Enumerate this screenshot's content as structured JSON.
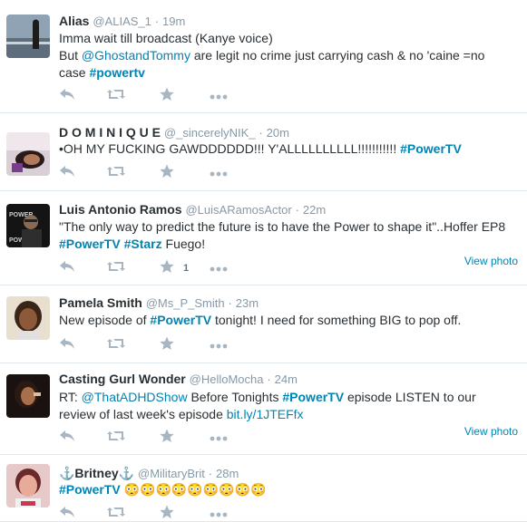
{
  "tweets": [
    {
      "name": "Alias",
      "handle": "@ALIAS_1",
      "time": "19m",
      "lines": [
        [
          {
            "t": "Imma wait till broadcast (Kanye voice)",
            "k": "text"
          }
        ],
        [
          {
            "t": "But ",
            "k": "text"
          },
          {
            "t": "@GhostandTommy",
            "k": "link"
          },
          {
            "t": " are legit no crime just carrying cash & no 'caine =no",
            "k": "text"
          }
        ],
        [
          {
            "t": "case ",
            "k": "text"
          },
          {
            "t": "#powertv",
            "k": "hashtag"
          }
        ]
      ],
      "fav_count": "",
      "view_photo": ""
    },
    {
      "name": "D O M I N I Q U E",
      "handle": "@_sincerelyNIK_",
      "time": "20m",
      "lines": [
        [
          {
            "t": "•OH MY FUCKING GAWDDDDDD!!! Y'ALLLLLLLLLL!!!!!!!!!!! ",
            "k": "text"
          },
          {
            "t": "#PowerTV",
            "k": "hashtag"
          }
        ]
      ],
      "fav_count": "",
      "view_photo": ""
    },
    {
      "name": "Luis Antonio Ramos",
      "handle": "@LuisARamosActor",
      "time": "22m",
      "lines": [
        [
          {
            "t": "\"The only way to predict the future is to have the Power to shape it\"..Hoffer EP8",
            "k": "text"
          }
        ],
        [
          {
            "t": "#PowerTV",
            "k": "hashtag"
          },
          {
            "t": " ",
            "k": "text"
          },
          {
            "t": "#Starz",
            "k": "hashtag"
          },
          {
            "t": " Fuego!",
            "k": "text"
          }
        ]
      ],
      "fav_count": "1",
      "view_photo": "View photo"
    },
    {
      "name": "Pamela Smith",
      "handle": "@Ms_P_Smith",
      "time": "23m",
      "lines": [
        [
          {
            "t": "New episode of ",
            "k": "text"
          },
          {
            "t": "#PowerTV",
            "k": "hashtag"
          },
          {
            "t": " tonight! I need for something BIG to pop off.",
            "k": "text"
          }
        ]
      ],
      "fav_count": "",
      "view_photo": ""
    },
    {
      "name": "Casting Gurl Wonder",
      "handle": "@HelloMocha",
      "time": "24m",
      "lines": [
        [
          {
            "t": "RT: ",
            "k": "text"
          },
          {
            "t": "@ThatADHDShow",
            "k": "link"
          },
          {
            "t": " Before Tonights ",
            "k": "text"
          },
          {
            "t": "#PowerTV",
            "k": "hashtag"
          },
          {
            "t": " episode LISTEN to our",
            "k": "text"
          }
        ],
        [
          {
            "t": "review of last week's episode ",
            "k": "text"
          },
          {
            "t": "bit.ly/1JTEFfx",
            "k": "link"
          }
        ]
      ],
      "fav_count": "",
      "view_photo": "View photo"
    },
    {
      "name": "⚓Britney⚓",
      "handle": "@MilitaryBrit",
      "time": "28m",
      "lines": [
        [
          {
            "t": "#PowerTV",
            "k": "hashtag"
          },
          {
            "t": " 😳😳😳😳😳😳😳😳😳",
            "k": "text"
          }
        ]
      ],
      "fav_count": "",
      "view_photo": ""
    }
  ],
  "separator": "·",
  "icons": {
    "reply": "reply-icon",
    "retweet": "retweet-icon",
    "favorite": "star-icon",
    "more": "more-dots-icon"
  },
  "colors": {
    "link": "#0084b4",
    "text": "#292f33",
    "meta": "#8899a6",
    "icon": "#a7b6c2",
    "divider": "#e1e8ed"
  }
}
